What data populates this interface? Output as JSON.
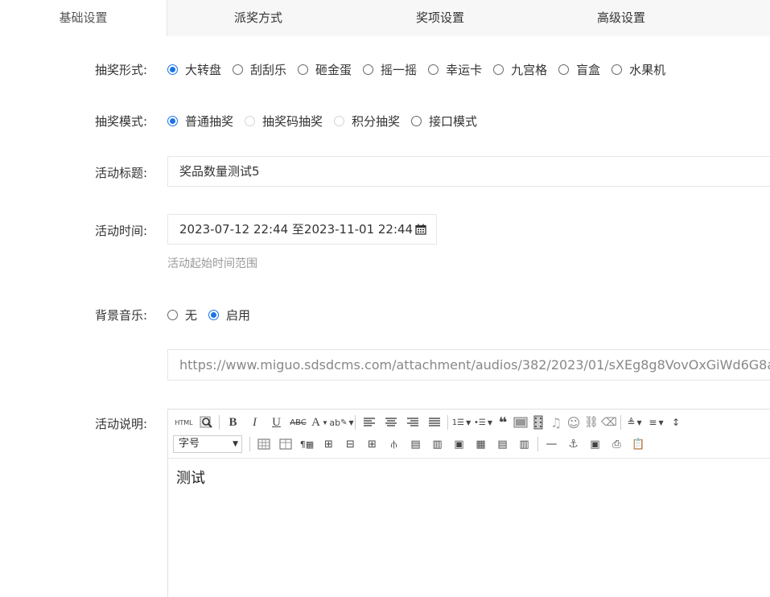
{
  "tabs": [
    "基础设置",
    "派奖方式",
    "奖项设置",
    "高级设置"
  ],
  "form": {
    "lottery_form": {
      "label": "抽奖形式:",
      "options": [
        "大转盘",
        "刮刮乐",
        "砸金蛋",
        "摇一摇",
        "幸运卡",
        "九宫格",
        "盲盒",
        "水果机"
      ],
      "selected": "大转盘"
    },
    "lottery_mode": {
      "label": "抽奖模式:",
      "options": [
        "普通抽奖",
        "抽奖码抽奖",
        "积分抽奖",
        "接口模式"
      ],
      "selected": "普通抽奖",
      "disabled": [
        "抽奖码抽奖",
        "积分抽奖"
      ]
    },
    "title": {
      "label": "活动标题:",
      "value": "奖品数量测试5"
    },
    "time": {
      "label": "活动时间:",
      "value": "2023-07-12 22:44 至2023-11-01 22:44",
      "hint": "活动起始时间范围"
    },
    "music": {
      "label": "背景音乐:",
      "options": [
        "无",
        "启用"
      ],
      "selected": "启用",
      "url": "https://www.miguo.sdsdcms.com/attachment/audios/382/2023/01/sXEg8g8VovOxGiWd6G8a8Wo"
    },
    "description": {
      "label": "活动说明:",
      "font_size_select": "字号",
      "content": "测试"
    }
  },
  "colors": {
    "accent": "#1a73e8",
    "tab_bg": "#f7f7f7",
    "border": "#e6e6e6"
  }
}
